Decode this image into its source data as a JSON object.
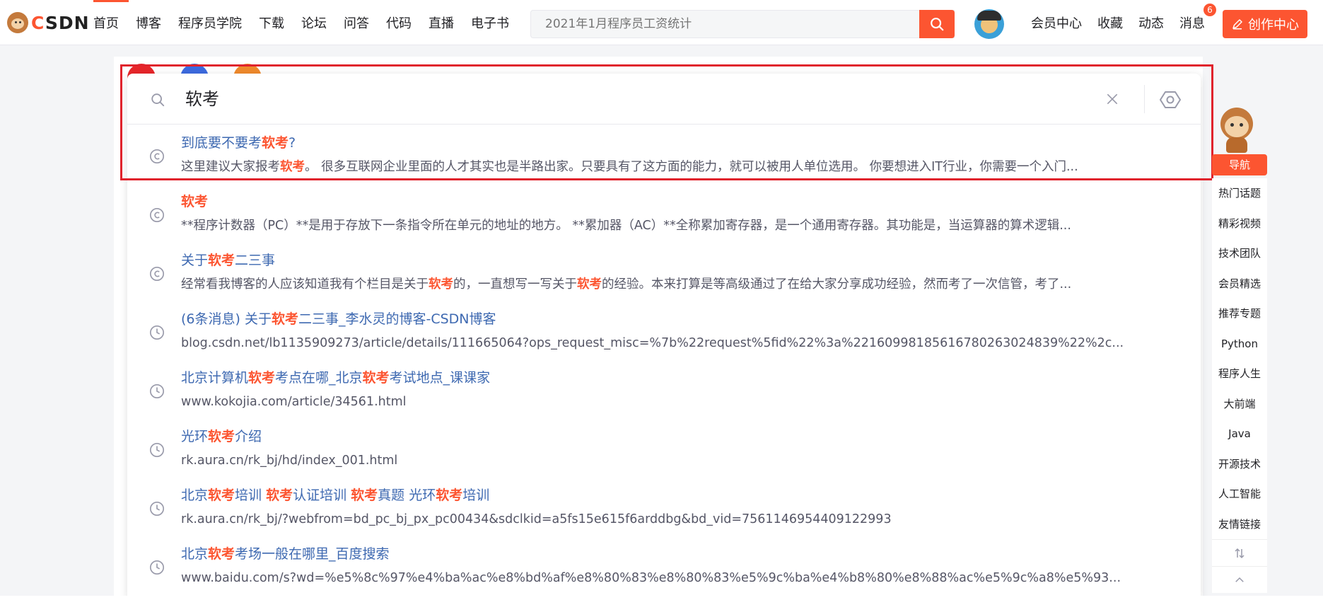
{
  "header": {
    "logo_text_c": "C",
    "logo_text_rest": "SDN",
    "nav": [
      "首页",
      "博客",
      "程序员学院",
      "下载",
      "论坛",
      "问答",
      "代码",
      "直播",
      "电子书"
    ],
    "search_placeholder": "2021年1月程序员工资统计",
    "right_links": [
      "会员中心",
      "收藏",
      "动态",
      "消息"
    ],
    "message_badge": "6",
    "create_label": "创作中心",
    "accent": "#fc5531"
  },
  "dropdown": {
    "query": "软考",
    "results": [
      {
        "icon": "copyright-icon",
        "title_html": "到底要不要考<b>软考</b>?",
        "desc_html": "这里建议大家报考<b>软考</b>。 很多互联网企业里面的人才其实也是半路出家。只要具有了这方面的能力，就可以被用人单位选用。 你要想进入IT行业，你需要一个入门..."
      },
      {
        "icon": "copyright-icon",
        "title_html": "<b>软考</b>",
        "desc_html": "**程序计数器（PC）**是用于存放下一条指令所在单元的地址的地方。 **累加器（AC）**全称累加寄存器，是一个通用寄存器。其功能是，当运算器的算术逻辑..."
      },
      {
        "icon": "copyright-icon",
        "title_html": "关于<b>软考</b>二三事",
        "desc_html": "经常看我博客的人应该知道我有个栏目是关于<b>软考</b>的，一直想写一写关于<b>软考</b>的经验。本来打算是等高级通过了在给大家分享成功经验，然而考了一次信管，考了..."
      },
      {
        "icon": "clock-icon",
        "title_html": "(6条消息) 关于<b>软考</b>二三事_李水灵的博客-CSDN博客",
        "desc_html": "blog.csdn.net/lb1135909273/article/details/111665064?ops_request_misc=%7b%22request%5fid%22%3a%22160998185616780263024839%22%2c..."
      },
      {
        "icon": "clock-icon",
        "title_html": "北京计算机<b>软考</b>考点在哪_北京<b>软考</b>考试地点_课课家",
        "desc_html": "www.kokojia.com/article/34561.html"
      },
      {
        "icon": "clock-icon",
        "title_html": "光环<b>软考</b>介绍",
        "desc_html": "rk.aura.cn/rk_bj/hd/index_001.html"
      },
      {
        "icon": "clock-icon",
        "title_html": "北京<b>软考</b>培训 <b>软考</b>认证培训 <b>软考</b>真题 光环<b>软考</b>培训",
        "desc_html": "rk.aura.cn/rk_bj/?webfrom=bd_pc_bj_px_pc00434&sdclkid=a5fs15e615f6arddbg&bd_vid=7561146954409122993"
      },
      {
        "icon": "clock-icon",
        "title_html": "北京<b>软考</b>考场一般在哪里_百度搜索",
        "desc_html": "www.baidu.com/s?wd=%e5%8c%97%e4%ba%ac%e8%bd%af%e8%80%83%e8%80%83%e5%9c%ba%e4%b8%80%e8%88%ac%e5%9c%a8%e5%93..."
      }
    ]
  },
  "sidebar": {
    "nav_label": "导航",
    "items": [
      "热门话题",
      "精彩视频",
      "技术团队",
      "会员精选",
      "推荐专题",
      "Python",
      "程序人生",
      "大前端",
      "Java",
      "开源技术",
      "人工智能",
      "友情链接"
    ]
  }
}
